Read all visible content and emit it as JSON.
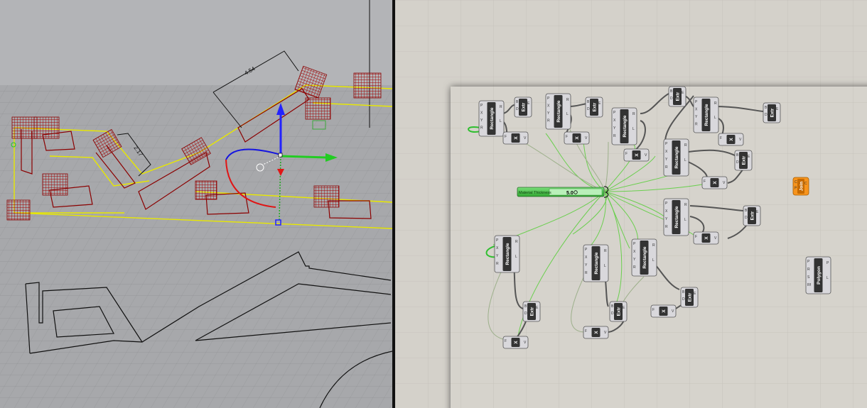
{
  "viewport": {
    "dimension_a": "4.54",
    "dimension_b": "2.17"
  },
  "canvas": {
    "slider": {
      "label": "Material Thickness",
      "value": "5.0"
    },
    "components": [
      {
        "id": "rect1",
        "label": "Rectangle",
        "inputs": [
          "P",
          "X",
          "Y",
          "R"
        ],
        "outputs": [
          "R",
          "L"
        ]
      },
      {
        "id": "extr1",
        "label": "Extr",
        "inputs": [
          "B",
          "D"
        ],
        "outputs": [
          "E"
        ]
      },
      {
        "id": "x1",
        "label": "X",
        "inputs": [
          "F"
        ],
        "outputs": [
          "V"
        ]
      },
      {
        "id": "rect2",
        "label": "Rectangle",
        "inputs": [
          "P",
          "X",
          "Y",
          "R"
        ],
        "outputs": [
          "R",
          "L"
        ]
      },
      {
        "id": "extr2",
        "label": "Extr",
        "inputs": [
          "B",
          "D"
        ],
        "outputs": [
          "E"
        ]
      },
      {
        "id": "x2",
        "label": "X",
        "inputs": [
          "F"
        ],
        "outputs": [
          "V"
        ]
      },
      {
        "id": "rect3",
        "label": "Rectangle",
        "inputs": [
          "P",
          "X",
          "Y",
          "R"
        ],
        "outputs": [
          "R",
          "L"
        ]
      },
      {
        "id": "x3",
        "label": "X",
        "inputs": [
          "F"
        ],
        "outputs": [
          "V"
        ]
      },
      {
        "id": "extr3",
        "label": "Extr",
        "inputs": [
          "B",
          "D"
        ],
        "outputs": [
          "E"
        ]
      },
      {
        "id": "rect4",
        "label": "Rectangle",
        "inputs": [
          "P",
          "X",
          "Y",
          "R"
        ],
        "outputs": [
          "R",
          "L"
        ]
      },
      {
        "id": "rect5",
        "label": "Rectangle",
        "inputs": [
          "P",
          "X",
          "Y",
          "R"
        ],
        "outputs": [
          "R",
          "L"
        ]
      },
      {
        "id": "x4",
        "label": "X",
        "inputs": [
          "F"
        ],
        "outputs": [
          "V"
        ]
      },
      {
        "id": "extr4",
        "label": "Extr",
        "inputs": [
          "B",
          "D"
        ],
        "outputs": [
          "E"
        ]
      },
      {
        "id": "extr5",
        "label": "Extr",
        "inputs": [
          "B",
          "D"
        ],
        "outputs": [
          "E"
        ]
      },
      {
        "id": "x5",
        "label": "X",
        "inputs": [
          "F"
        ],
        "outputs": [
          "V"
        ]
      },
      {
        "id": "join1",
        "label": "Join",
        "inputs": [
          "C",
          "P"
        ],
        "outputs": [
          "C"
        ]
      },
      {
        "id": "rect6",
        "label": "Rectangle",
        "inputs": [
          "P",
          "X",
          "Y",
          "R"
        ],
        "outputs": [
          "R",
          "L"
        ]
      },
      {
        "id": "extr6",
        "label": "Extr",
        "inputs": [
          "B",
          "D"
        ],
        "outputs": [
          "E"
        ]
      },
      {
        "id": "x6",
        "label": "X",
        "inputs": [
          "F"
        ],
        "outputs": [
          "V"
        ]
      },
      {
        "id": "rect7",
        "label": "Rectangle",
        "inputs": [
          "P",
          "X",
          "Y",
          "R"
        ],
        "outputs": [
          "R",
          "L"
        ]
      },
      {
        "id": "extr7",
        "label": "Extr",
        "inputs": [
          "B",
          "D"
        ],
        "outputs": [
          "E"
        ]
      },
      {
        "id": "x7",
        "label": "X",
        "inputs": [
          "F"
        ],
        "outputs": [
          "V"
        ]
      },
      {
        "id": "rect8",
        "label": "Rectangle",
        "inputs": [
          "P",
          "X",
          "Y",
          "R"
        ],
        "outputs": [
          "R",
          "L"
        ]
      },
      {
        "id": "extr8",
        "label": "Extr",
        "inputs": [
          "B",
          "D"
        ],
        "outputs": [
          "E"
        ]
      },
      {
        "id": "x8",
        "label": "X",
        "inputs": [
          "F"
        ],
        "outputs": [
          "V"
        ]
      },
      {
        "id": "rect9",
        "label": "Rectangle",
        "inputs": [
          "P",
          "X",
          "Y",
          "R"
        ],
        "outputs": [
          "R",
          "L"
        ]
      },
      {
        "id": "extr9",
        "label": "Extr",
        "inputs": [
          "B",
          "D"
        ],
        "outputs": [
          "E"
        ]
      },
      {
        "id": "x9",
        "label": "X",
        "inputs": [
          "F"
        ],
        "outputs": [
          "V"
        ]
      },
      {
        "id": "extr10",
        "label": "Extr",
        "inputs": [
          "B",
          "D"
        ],
        "outputs": [
          "E"
        ]
      },
      {
        "id": "polygon1",
        "label": "Polygon",
        "inputs": [
          "P",
          "R",
          "S",
          "Rf"
        ],
        "outputs": [
          "P",
          "L"
        ]
      }
    ]
  },
  "colors": {
    "viewport_bg": "#a7a8ab",
    "canvas_bg": "#d4d1ca",
    "selection_yellow": "#e8e800",
    "object_red": "#8b0000",
    "wire_green": "#3cc83c",
    "join_orange": "#f7941d"
  }
}
